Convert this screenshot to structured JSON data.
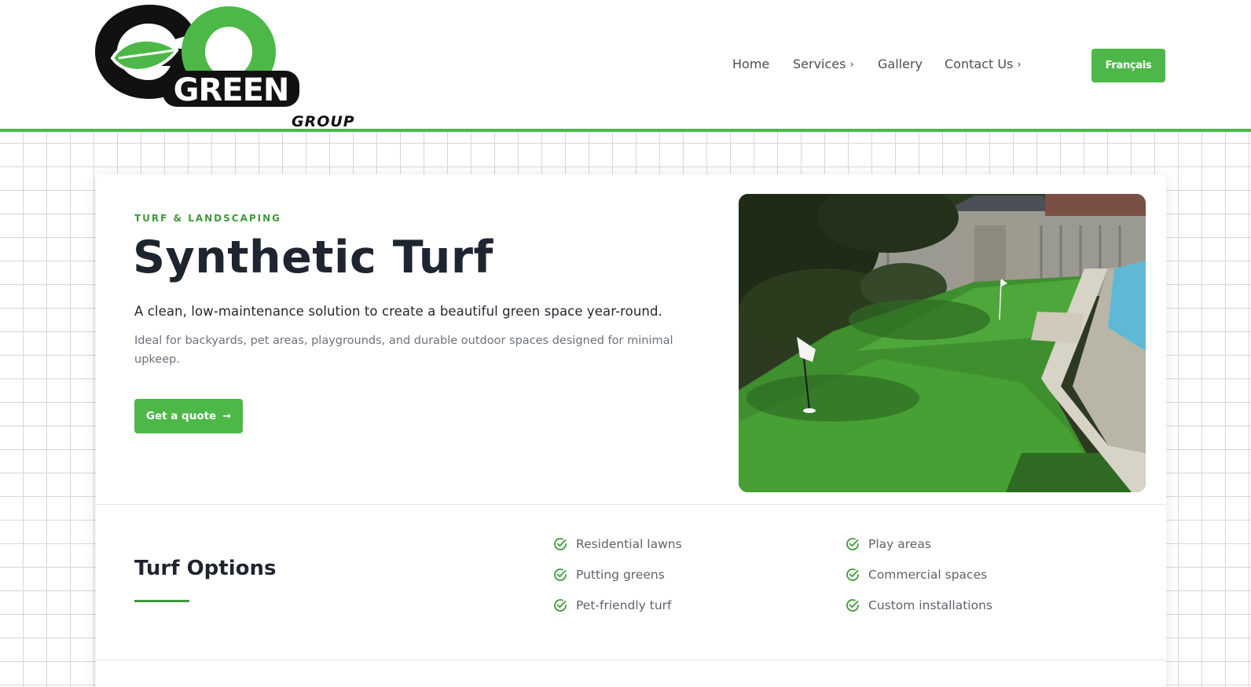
{
  "brand": {
    "logo_main": "GO",
    "logo_word": "GREEN",
    "logo_sub": "GROUP",
    "accent_color": "#4db848",
    "dark_green": "#3f9a3b"
  },
  "nav": {
    "items": [
      {
        "label": "Home",
        "has_submenu": false
      },
      {
        "label": "Services",
        "has_submenu": true
      },
      {
        "label": "Gallery",
        "has_submenu": false
      },
      {
        "label": "Contact Us",
        "has_submenu": true
      }
    ],
    "chevron_icon": "chevron-right-icon",
    "language_button": "Français"
  },
  "hero": {
    "eyebrow": "TURF & LANDSCAPING",
    "title": "Synthetic Turf",
    "lead": "A clean, low-maintenance solution to create a beautiful green space year-round.",
    "description": "Ideal for backyards, pet areas, playgrounds, and durable outdoor spaces designed for minimal upkeep.",
    "cta_label": "Get a quote",
    "cta_icon": "arrow-right-icon"
  },
  "options": {
    "title": "Turf Options",
    "icon": "check-circle-icon",
    "items": [
      "Residential lawns",
      "Putting greens",
      "Pet-friendly turf",
      "Play areas",
      "Commercial spaces",
      "Custom installations"
    ]
  }
}
